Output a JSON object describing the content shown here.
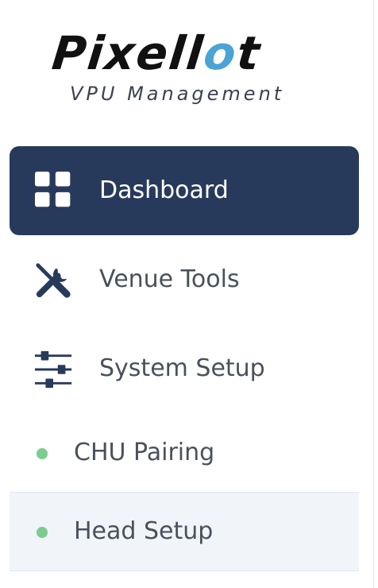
{
  "brand": {
    "name_part1": "Pixell",
    "name_accent": "o",
    "name_part2": "t",
    "subtitle": "VPU Management",
    "accent_color": "#4ba3d6"
  },
  "nav": {
    "active_color": "#283a5c",
    "items": [
      {
        "label": "Dashboard",
        "icon": "grid-icon",
        "active": true
      },
      {
        "label": "Venue Tools",
        "icon": "tools-icon",
        "active": false
      },
      {
        "label": "System Setup",
        "icon": "sliders-icon",
        "active": false
      }
    ],
    "sub_items": [
      {
        "label": "CHU Pairing",
        "status_color": "#7ccc8f",
        "selected": false
      },
      {
        "label": "Head Setup",
        "status_color": "#7ccc8f",
        "selected": true
      }
    ]
  }
}
